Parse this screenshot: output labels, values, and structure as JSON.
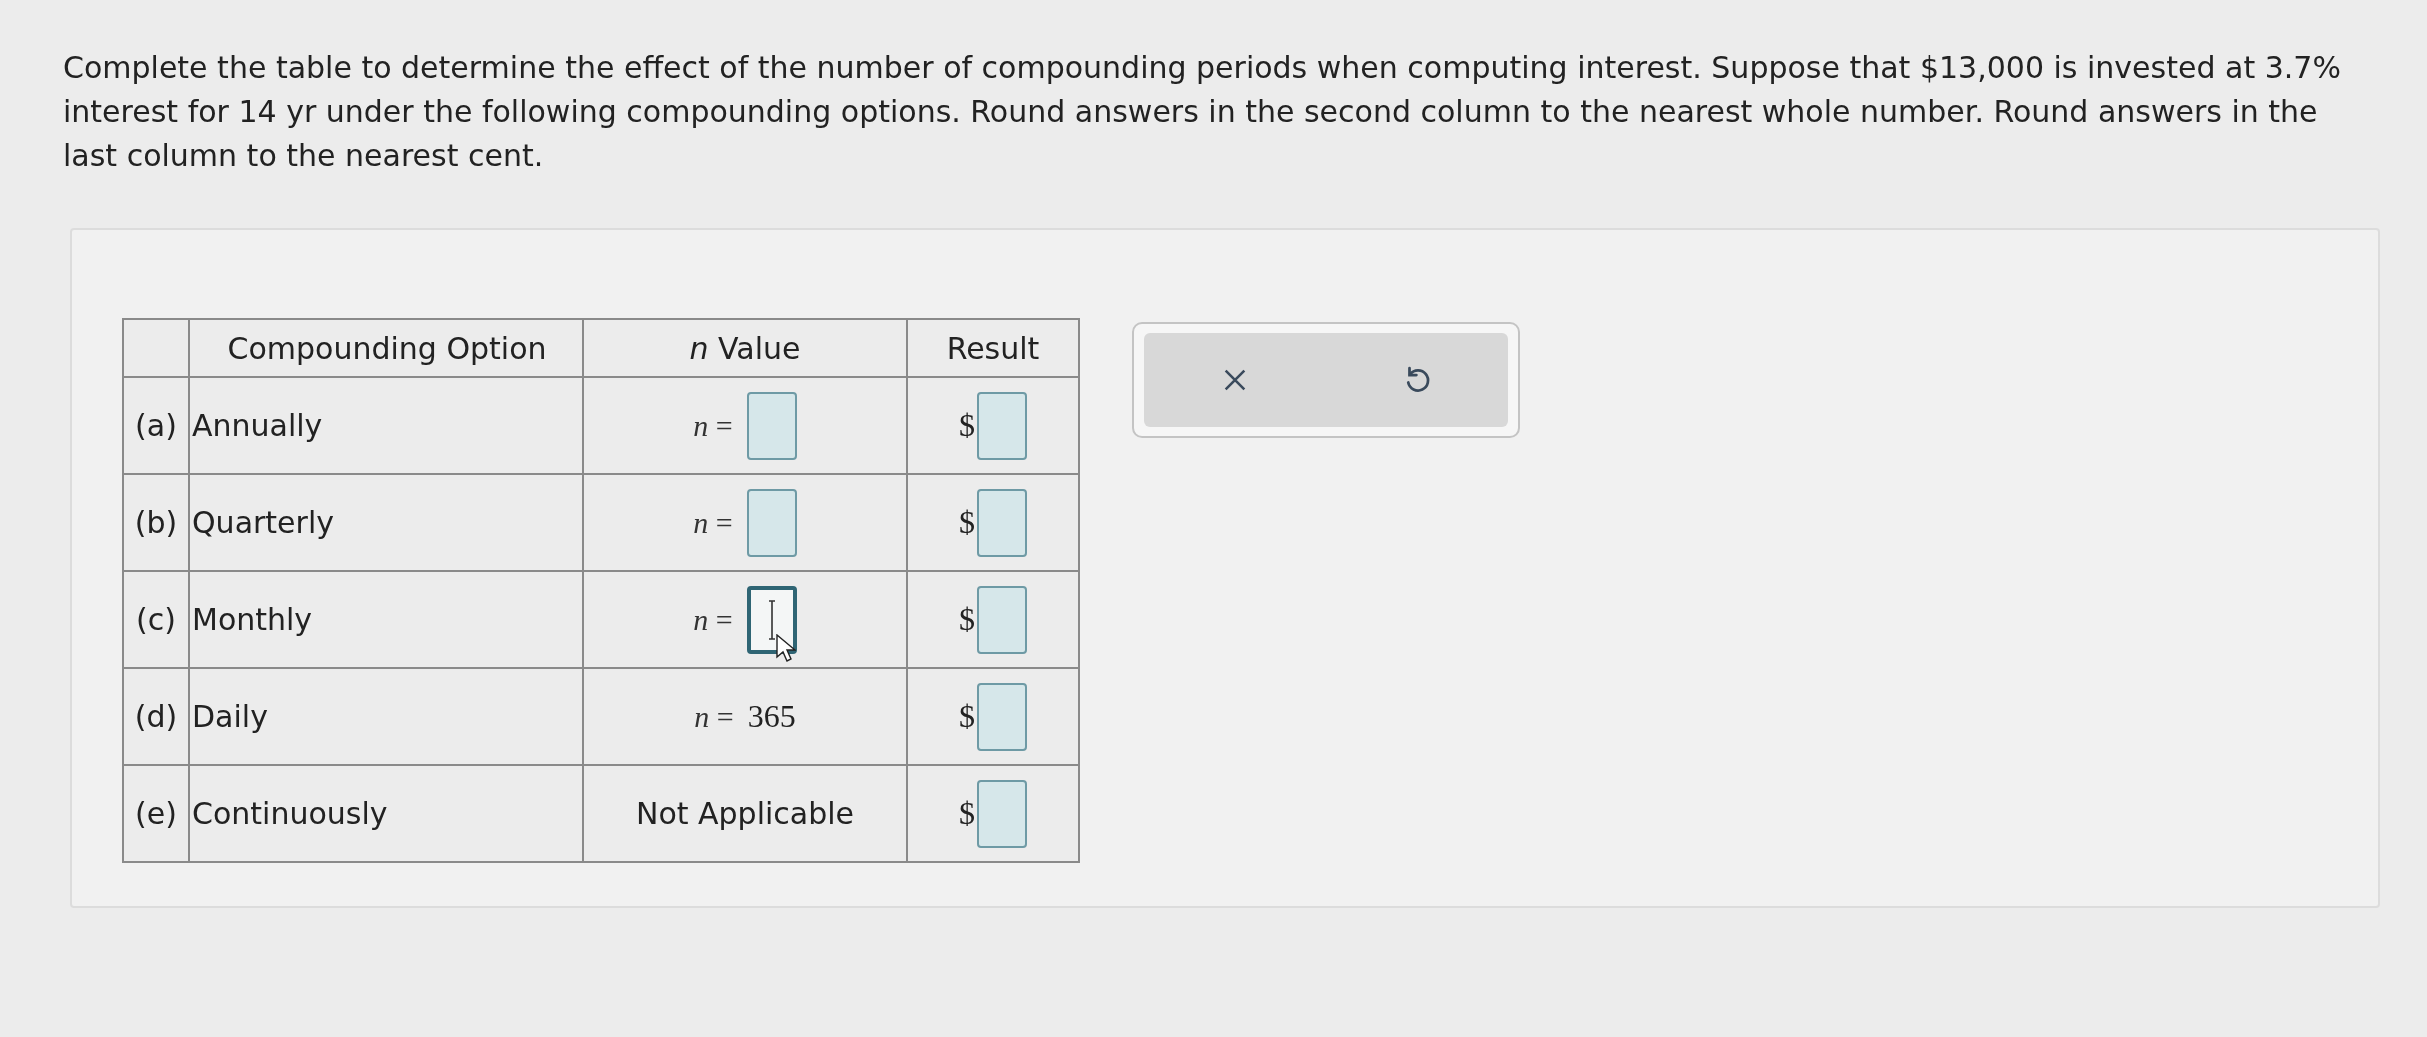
{
  "question": {
    "text": "Complete the table to determine the effect of the number of compounding periods when computing interest. Suppose that $13,000 is invested at 3.7% interest for 14 yr under the following compounding options. Round answers in the second column to the nearest whole number. Round answers in the last column to the nearest cent."
  },
  "table": {
    "columns": [
      "Compounding Option",
      "*n* Value",
      "Result"
    ],
    "rows": [
      {
        "letter": "(a)",
        "option": "Annually",
        "n": {
          "kind": "input",
          "label": "*n* =",
          "focused": false
        },
        "currency": "$"
      },
      {
        "letter": "(b)",
        "option": "Quarterly",
        "n": {
          "kind": "input",
          "label": "*n* =",
          "focused": false
        },
        "currency": "$"
      },
      {
        "letter": "(c)",
        "option": "Monthly",
        "n": {
          "kind": "input",
          "label": "*n* =",
          "focused": true
        },
        "currency": "$"
      },
      {
        "letter": "(d)",
        "option": "Daily",
        "n": {
          "kind": "value",
          "label": "*n* =",
          "value": "365"
        },
        "currency": "$"
      },
      {
        "letter": "(e)",
        "option": "Continuously",
        "n": {
          "kind": "text",
          "value": "Not Applicable"
        },
        "currency": "$"
      }
    ]
  }
}
